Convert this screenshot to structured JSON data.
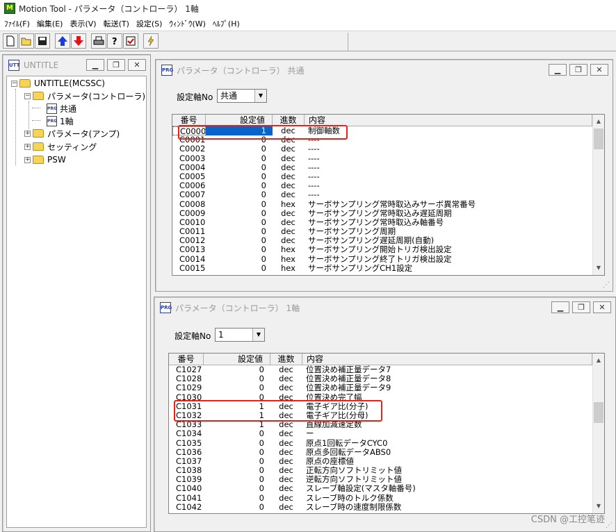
{
  "app": {
    "title": "Motion Tool - パラメータ（コントローラ） 1軸",
    "icon_text": "M"
  },
  "menu": [
    "ﾌｧｲﾙ(F)",
    "編集(E)",
    "表示(V)",
    "転送(T)",
    "設定(S)",
    "ｳｨﾝﾄﾞｳ(W)",
    "ﾍﾙﾌﾟ(H)"
  ],
  "toolbar": {
    "icons": [
      "new-file-icon",
      "open-folder-icon",
      "save-icon",
      "arrow-up-icon",
      "arrow-down-icon",
      "print-icon",
      "help-icon",
      "check-icon",
      "flash-icon"
    ]
  },
  "tree_window": {
    "title": "UNTITLE",
    "icon_text": "UTT",
    "nodes": [
      {
        "label": "UNTITLE(MCSSC)",
        "expander": "−"
      },
      {
        "label": "パラメータ(コントローラ)",
        "expander": "−"
      },
      {
        "label": "共通",
        "icon_text": "PRG"
      },
      {
        "label": "1軸",
        "icon_text": "PRG"
      },
      {
        "label": "パラメータ(アンプ)",
        "expander": "+"
      },
      {
        "label": "セッティング",
        "expander": "+"
      },
      {
        "label": "PSW",
        "expander": "+"
      }
    ]
  },
  "common_window": {
    "title": "パラメータ（コントローラ） 共通",
    "icon_text": "PRG",
    "axis_label": "設定軸No",
    "axis_value": "共通",
    "columns": [
      "番号",
      "設定値",
      "進数",
      "内容"
    ],
    "rows": [
      {
        "no": "C0000",
        "val": "1",
        "base": "dec",
        "desc": "制御軸数"
      },
      {
        "no": "C0001",
        "val": "0",
        "base": "dec",
        "desc": "----"
      },
      {
        "no": "C0002",
        "val": "0",
        "base": "dec",
        "desc": "----"
      },
      {
        "no": "C0003",
        "val": "0",
        "base": "dec",
        "desc": "----"
      },
      {
        "no": "C0004",
        "val": "0",
        "base": "dec",
        "desc": "----"
      },
      {
        "no": "C0005",
        "val": "0",
        "base": "dec",
        "desc": "----"
      },
      {
        "no": "C0006",
        "val": "0",
        "base": "dec",
        "desc": "----"
      },
      {
        "no": "C0007",
        "val": "0",
        "base": "dec",
        "desc": "----"
      },
      {
        "no": "C0008",
        "val": "0",
        "base": "hex",
        "desc": "サーボサンプリング常時取込みサーボ異常番号"
      },
      {
        "no": "C0009",
        "val": "0",
        "base": "dec",
        "desc": "サーボサンプリング常時取込み遅延周期"
      },
      {
        "no": "C0010",
        "val": "0",
        "base": "dec",
        "desc": "サーボサンプリング常時取込み軸番号"
      },
      {
        "no": "C0011",
        "val": "0",
        "base": "dec",
        "desc": "サーボサンプリング周期"
      },
      {
        "no": "C0012",
        "val": "0",
        "base": "dec",
        "desc": "サーボサンプリング遅延周期(自動)"
      },
      {
        "no": "C0013",
        "val": "0",
        "base": "hex",
        "desc": "サーボサンプリング開始トリガ検出設定"
      },
      {
        "no": "C0014",
        "val": "0",
        "base": "hex",
        "desc": "サーボサンプリング終了トリガ検出設定"
      },
      {
        "no": "C0015",
        "val": "0",
        "base": "hex",
        "desc": "サーボサンプリングCH1設定"
      }
    ]
  },
  "axis1_window": {
    "title": "パラメータ（コントローラ） 1軸",
    "icon_text": "PRG",
    "axis_label": "設定軸No",
    "axis_value": "1",
    "columns": [
      "番号",
      "設定値",
      "進数",
      "内容"
    ],
    "rows": [
      {
        "no": "C1027",
        "val": "0",
        "base": "dec",
        "desc": "位置決め補正量データ7"
      },
      {
        "no": "C1028",
        "val": "0",
        "base": "dec",
        "desc": "位置決め補正量データ8"
      },
      {
        "no": "C1029",
        "val": "0",
        "base": "dec",
        "desc": "位置決め補正量データ9"
      },
      {
        "no": "C1030",
        "val": "0",
        "base": "dec",
        "desc": "位置決め完了幅"
      },
      {
        "no": "C1031",
        "val": "1",
        "base": "dec",
        "desc": "電子ギア比(分子)"
      },
      {
        "no": "C1032",
        "val": "1",
        "base": "dec",
        "desc": "電子ギア比(分母)"
      },
      {
        "no": "C1033",
        "val": "1",
        "base": "dec",
        "desc": "直線加減速定数"
      },
      {
        "no": "C1034",
        "val": "0",
        "base": "dec",
        "desc": "ー"
      },
      {
        "no": "C1035",
        "val": "0",
        "base": "dec",
        "desc": "原点1回転データCYC0"
      },
      {
        "no": "C1036",
        "val": "0",
        "base": "dec",
        "desc": "原点多回転データABS0"
      },
      {
        "no": "C1037",
        "val": "0",
        "base": "dec",
        "desc": "原点の座標値"
      },
      {
        "no": "C1038",
        "val": "0",
        "base": "dec",
        "desc": "正転方向ソフトリミット値"
      },
      {
        "no": "C1039",
        "val": "0",
        "base": "dec",
        "desc": "逆転方向ソフトリミット値"
      },
      {
        "no": "C1040",
        "val": "0",
        "base": "dec",
        "desc": "スレーブ軸設定(マスタ軸番号)"
      },
      {
        "no": "C1041",
        "val": "0",
        "base": "dec",
        "desc": "スレーブ時のトルク係数"
      },
      {
        "no": "C1042",
        "val": "0",
        "base": "dec",
        "desc": "スレーブ時の速度制限係数"
      }
    ]
  },
  "watermark": "CSDN @工控笔迹",
  "colors": {
    "highlight": "#e8201a",
    "selection": "#0a64c8"
  }
}
